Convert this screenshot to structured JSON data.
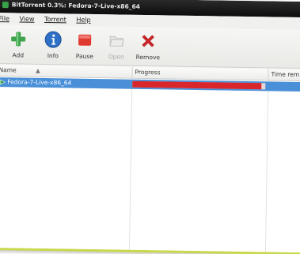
{
  "window": {
    "title": "BitTorrent 0.3%: Fedora-7-Live-x86_64"
  },
  "menu": {
    "items": [
      "File",
      "View",
      "Torrent",
      "Help"
    ]
  },
  "toolbar": {
    "add_label": "Add",
    "info_label": "Info",
    "pause_label": "Pause",
    "open_label": "Open",
    "remove_label": "Remove",
    "colors": {
      "add": "#3fa34d",
      "info": "#2f6fc6",
      "pause": "#e0392f",
      "remove": "#d8262a"
    }
  },
  "list": {
    "columns": {
      "name": "Name",
      "progress": "Progress",
      "time_remaining": "Time rem"
    },
    "rows": [
      {
        "name": "Fedora-7-Live-x86_64",
        "progress": 0.97,
        "selected": true
      }
    ]
  },
  "colors": {
    "selection": "#4a90d9",
    "progress_bar": "#d8262a",
    "frame_accent": "#c8d84a"
  }
}
